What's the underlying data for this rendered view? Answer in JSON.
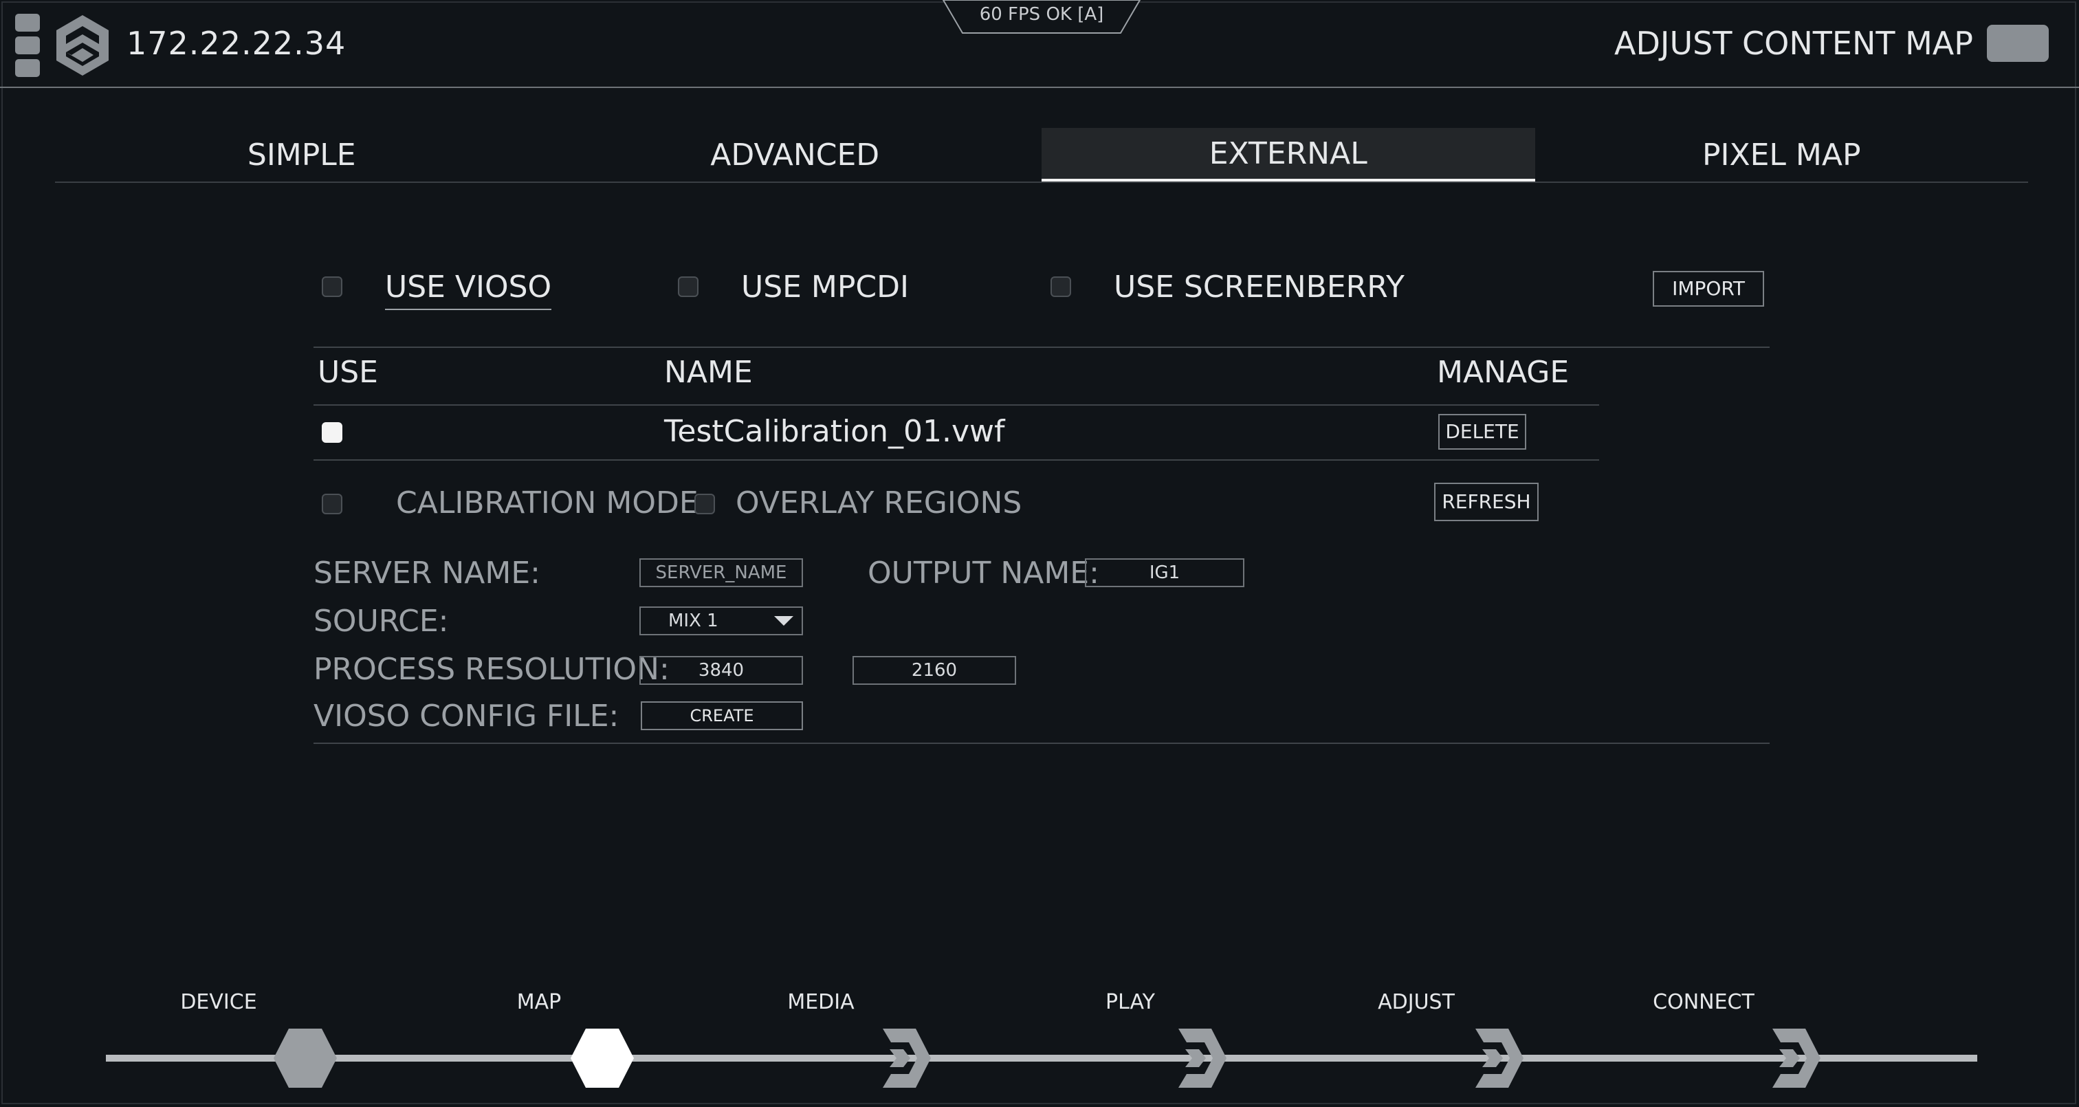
{
  "header": {
    "ip_address": "172.22.22.34",
    "fps_status": "60 FPS OK [A]",
    "adjust_content_map_label": "ADJUST CONTENT MAP"
  },
  "tabs": [
    {
      "label": "SIMPLE",
      "active": false
    },
    {
      "label": "ADVANCED",
      "active": false
    },
    {
      "label": "EXTERNAL",
      "active": true
    },
    {
      "label": "PIXEL MAP",
      "active": false
    }
  ],
  "external": {
    "use_vioso": "USE VIOSO",
    "use_mpcdi": "USE MPCDI",
    "use_screenberry": "USE SCREENBERRY",
    "import_button": "IMPORT",
    "table": {
      "headers": {
        "use": "USE",
        "name": "NAME",
        "manage": "MANAGE"
      },
      "rows": [
        {
          "name": "TestCalibration_01.vwf",
          "delete_label": "DELETE",
          "checked": true
        }
      ]
    },
    "calibration_mode": "CALIBRATION MODE",
    "overlay_regions": "OVERLAY REGIONS",
    "refresh_button": "REFRESH",
    "server_name_label": "SERVER NAME:",
    "server_name_placeholder": "SERVER_NAME",
    "output_name_label": "OUTPUT NAME:",
    "output_name_value": "IG1",
    "source_label": "SOURCE:",
    "source_value": "MIX 1",
    "process_resolution_label": "PROCESS RESOLUTION:",
    "resolution_width": "3840",
    "resolution_height": "2160",
    "vioso_config_label": "VIOSO CONFIG FILE:",
    "create_button": "CREATE"
  },
  "workflow": [
    {
      "label": "DEVICE",
      "state": "done"
    },
    {
      "label": "MAP",
      "state": "current"
    },
    {
      "label": "MEDIA",
      "state": "pending"
    },
    {
      "label": "PLAY",
      "state": "pending"
    },
    {
      "label": "ADJUST",
      "state": "pending"
    },
    {
      "label": "CONNECT",
      "state": "pending"
    }
  ],
  "colors": {
    "background": "#101418",
    "accent": "#f2f2f2",
    "muted": "#9ca1a6",
    "done_hex": "#9a9ea2"
  }
}
